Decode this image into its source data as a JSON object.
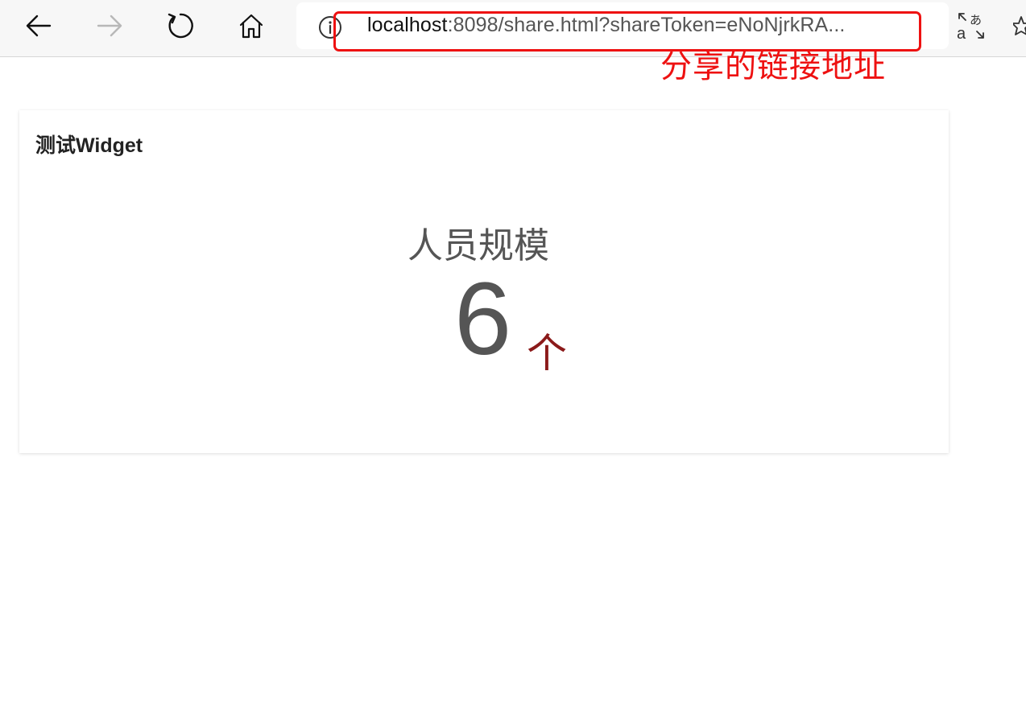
{
  "browser": {
    "url_host": "localhost",
    "url_rest": ":8098/share.html?shareToken=eNoNjrkRA...",
    "nav_icons": [
      "back-arrow-icon",
      "forward-arrow-icon",
      "reload-icon",
      "home-icon",
      "info-icon",
      "translate-icon",
      "favorite-star-icon"
    ]
  },
  "annotation": {
    "label": "分享的链接地址",
    "color": "#ee1111"
  },
  "widget": {
    "title": "测试Widget",
    "metric_label": "人员规模",
    "metric_value": "6",
    "metric_unit": "个",
    "unit_color": "#8b1a1a"
  }
}
